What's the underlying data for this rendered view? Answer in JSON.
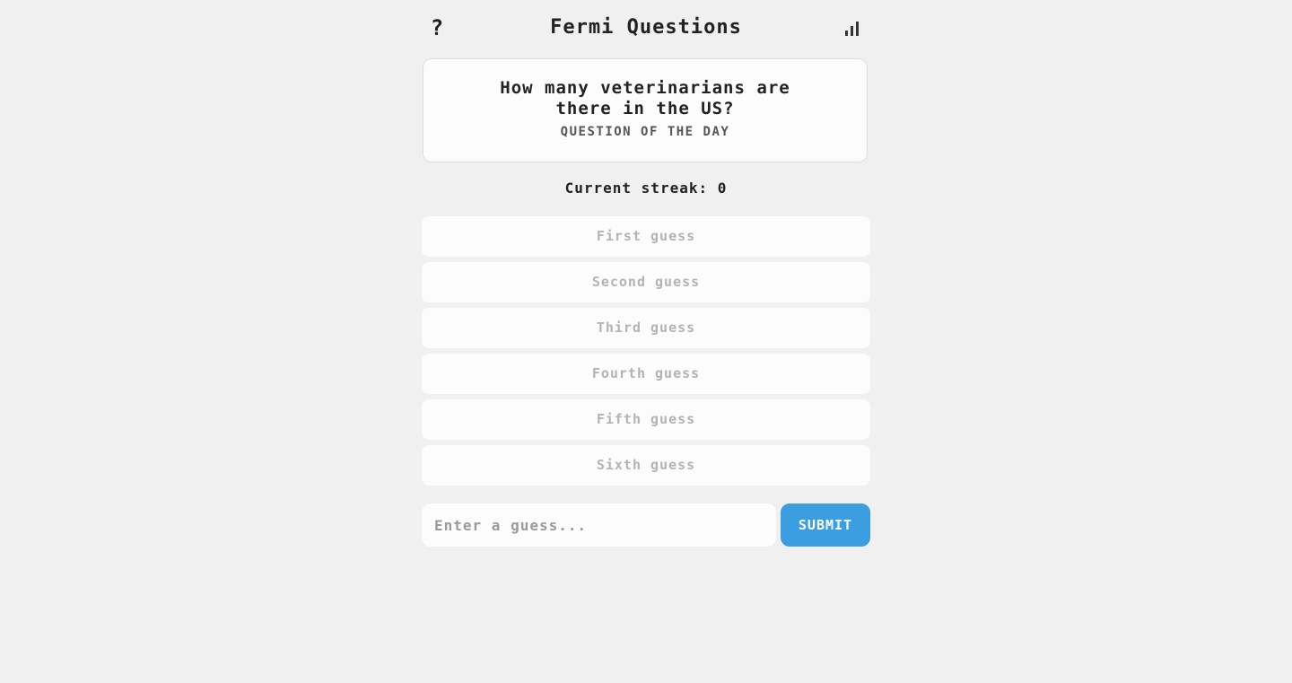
{
  "header": {
    "help_label": "?",
    "title": "Fermi Questions",
    "stats_icon": "bar-chart-icon"
  },
  "question": {
    "text": "How many veterinarians are there in the US?",
    "subtitle": "QUESTION OF THE DAY"
  },
  "streak": {
    "text": "Current streak: 0"
  },
  "guesses": [
    {
      "label": "First guess"
    },
    {
      "label": "Second guess"
    },
    {
      "label": "Third guess"
    },
    {
      "label": "Fourth guess"
    },
    {
      "label": "Fifth guess"
    },
    {
      "label": "Sixth guess"
    }
  ],
  "input": {
    "placeholder": "Enter a guess...",
    "value": ""
  },
  "submit": {
    "label": "SUBMIT"
  },
  "colors": {
    "background": "#f0f0f0",
    "card": "#fcfcfc",
    "accent": "#3a9ee0",
    "muted_text": "#b3b3b3"
  }
}
